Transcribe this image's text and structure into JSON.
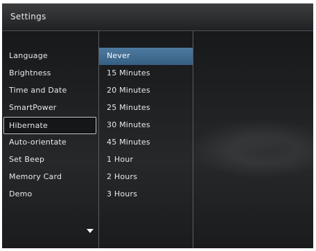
{
  "title": "Settings",
  "menu": {
    "items": [
      {
        "label": "Language",
        "slug": "language"
      },
      {
        "label": "Brightness",
        "slug": "brightness"
      },
      {
        "label": "Time and Date",
        "slug": "time-and-date"
      },
      {
        "label": "SmartPower",
        "slug": "smartpower"
      },
      {
        "label": "Hibernate",
        "slug": "hibernate"
      },
      {
        "label": "Auto-orientate",
        "slug": "auto-orientate"
      },
      {
        "label": "Set Beep",
        "slug": "set-beep"
      },
      {
        "label": "Memory Card",
        "slug": "memory-card"
      },
      {
        "label": "Demo",
        "slug": "demo"
      }
    ],
    "focused_index": 4,
    "more_icon": "chevron-down-icon"
  },
  "options": {
    "items": [
      "Never",
      "15 Minutes",
      "20 Minutes",
      "25 Minutes",
      "30 Minutes",
      "45 Minutes",
      "1 Hour",
      "2 Hours",
      "3 Hours"
    ],
    "selected_index": 0
  },
  "colors": {
    "selection": "#456f94",
    "focus_border": "#c8ccd0",
    "background": "#1d1f21"
  }
}
